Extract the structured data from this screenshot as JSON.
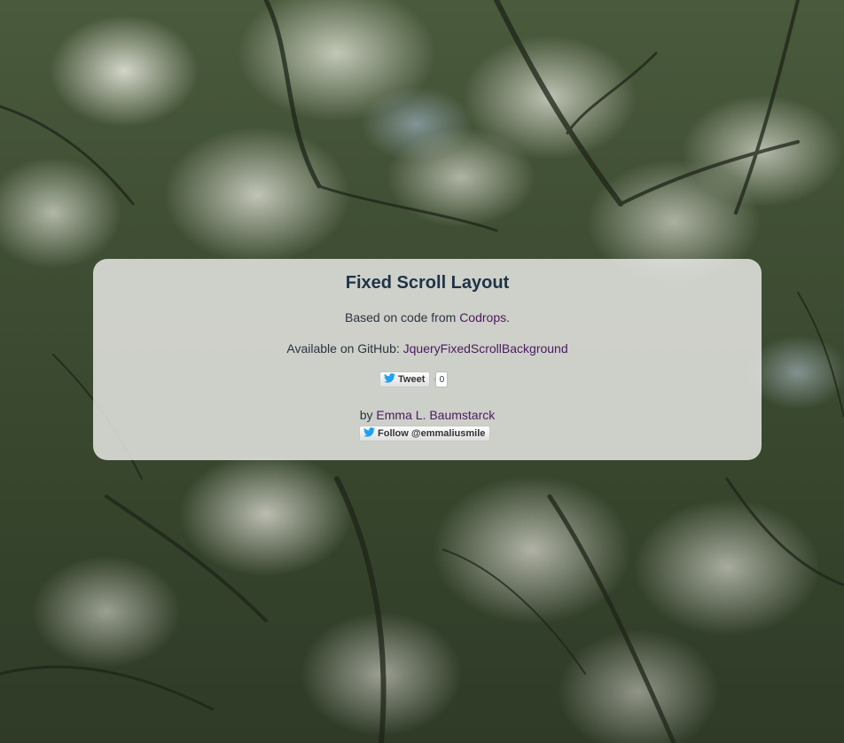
{
  "panel": {
    "title": "Fixed Scroll Layout",
    "codrops_prefix": "Based on code from ",
    "codrops_link": "Codrops",
    "codrops_suffix": ".",
    "github_prefix": "Available on GitHub: ",
    "github_link": "JqueryFixedScrollBackground",
    "tweet_label": "Tweet",
    "tweet_count": "0",
    "author_prefix": "by ",
    "author_link": "Emma L. Baumstarck",
    "follow_label": "Follow @emmaliusmile"
  },
  "icons": {
    "twitter": "twitter-bird-icon"
  },
  "colors": {
    "title": "#1f3347",
    "link": "#4a1a5e",
    "twitter_blue": "#1da1f2",
    "panel_bg": "#eeeeec"
  }
}
